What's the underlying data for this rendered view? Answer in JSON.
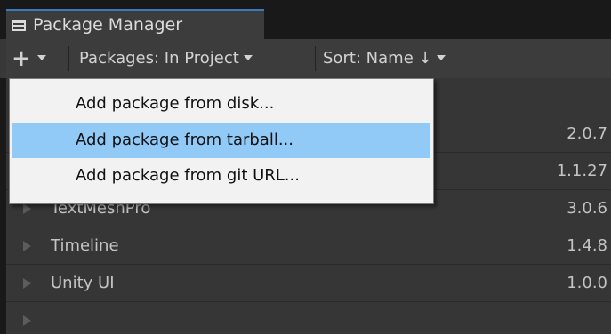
{
  "window": {
    "title": "Package Manager",
    "icon": "window-icon"
  },
  "toolbar": {
    "add_label": "+",
    "packages_filter": "Packages: In Project",
    "sort": "Sort: Name ↓"
  },
  "packages": [
    {
      "name": "",
      "version": "2.0.7"
    },
    {
      "name": "",
      "version": "1.1.27"
    },
    {
      "name": "TextMeshPro",
      "version": "3.0.6"
    },
    {
      "name": "Timeline",
      "version": "1.4.8"
    },
    {
      "name": "Unity UI",
      "version": "1.0.0"
    }
  ],
  "add_menu": {
    "items": [
      {
        "label": "Add package from disk...",
        "highlighted": false
      },
      {
        "label": "Add package from tarball...",
        "highlighted": true
      },
      {
        "label": "Add package from git URL...",
        "highlighted": false
      }
    ]
  },
  "colors": {
    "menu_highlight": "#91c9f7",
    "tab_accent": "#3a79bb",
    "background": "#383838"
  }
}
